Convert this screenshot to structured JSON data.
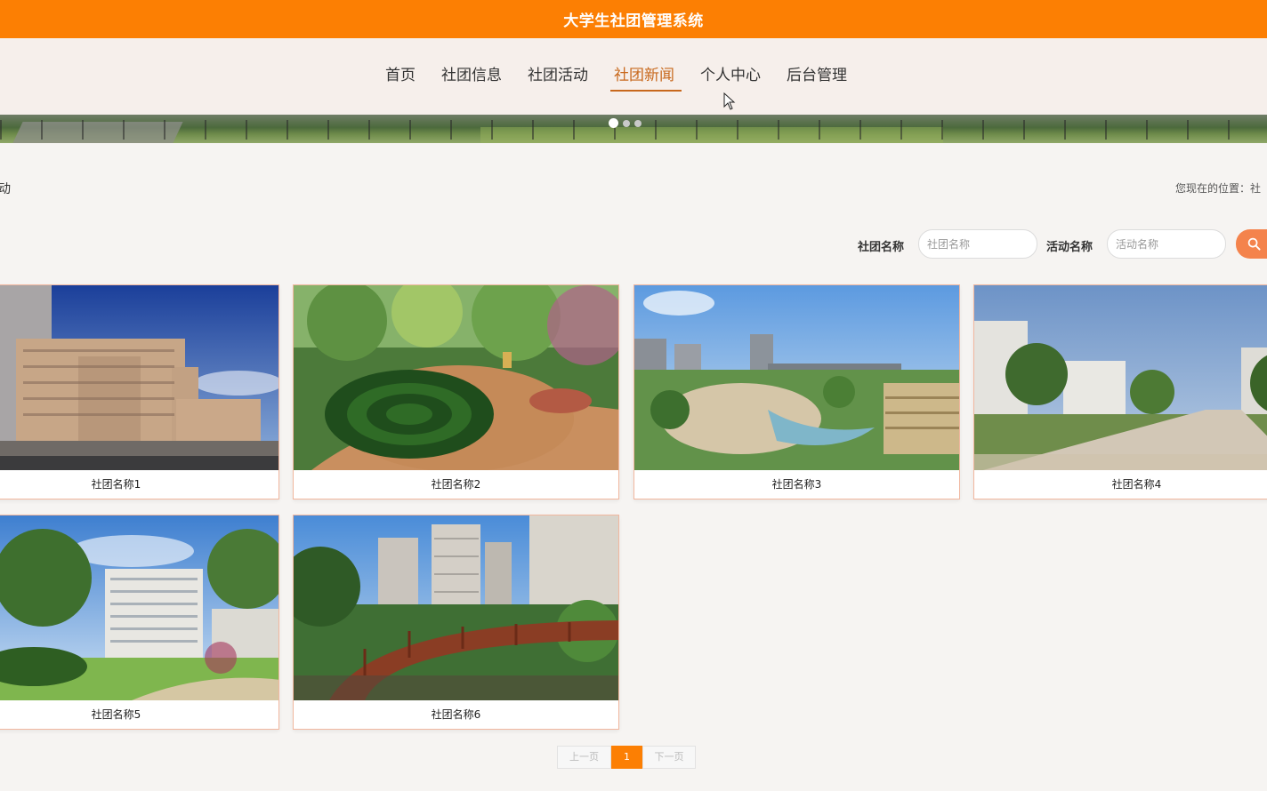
{
  "header": {
    "title": "大学生社团管理系统"
  },
  "nav": {
    "items": [
      {
        "label": "首页"
      },
      {
        "label": "社团信息"
      },
      {
        "label": "社团活动"
      },
      {
        "label": "社团新闻"
      },
      {
        "label": "个人中心"
      },
      {
        "label": "后台管理"
      }
    ],
    "active_index": 3
  },
  "banner": {
    "slide_count": 3,
    "active_slide": 0
  },
  "section": {
    "title": "动",
    "breadcrumb": "您现在的位置：社"
  },
  "search": {
    "club_label": "社团名称",
    "club_placeholder": "社团名称",
    "activity_label": "活动名称",
    "activity_placeholder": "活动名称",
    "button_icon": "search-icon"
  },
  "cards": [
    {
      "name": "社团名称1"
    },
    {
      "name": "社团名称2"
    },
    {
      "name": "社团名称3"
    },
    {
      "name": "社团名称4"
    },
    {
      "name": "社团名称5"
    },
    {
      "name": "社团名称6"
    }
  ],
  "pagination": {
    "prev": "上一页",
    "current": "1",
    "next": "下一页"
  },
  "colors": {
    "accent": "#fc7f03",
    "nav_active": "#c8681c",
    "card_border": "#f1b79f",
    "search_button": "#f4834c"
  }
}
